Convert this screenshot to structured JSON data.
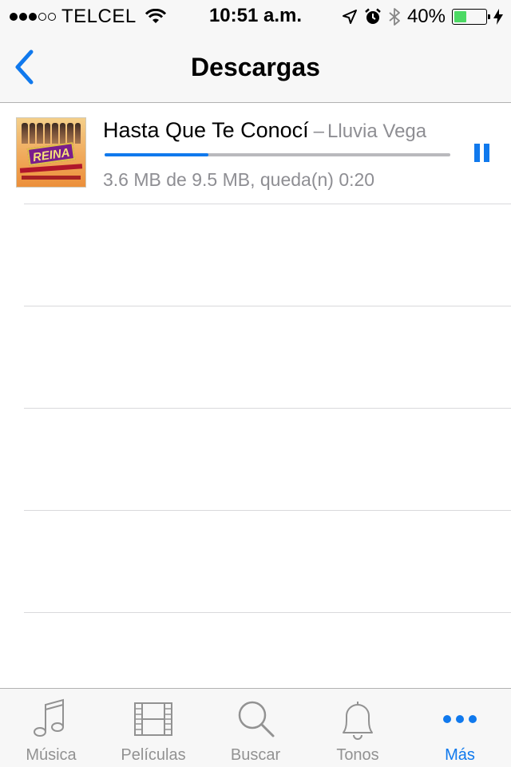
{
  "status_bar": {
    "signal_filled": 3,
    "signal_total": 5,
    "carrier": "TELCEL",
    "time": "10:51 a.m.",
    "battery_percent": "40%",
    "battery_level": 0.4,
    "icons": [
      "wifi-icon",
      "location-arrow-icon",
      "alarm-icon",
      "bluetooth-icon",
      "battery-icon",
      "charging-bolt-icon"
    ]
  },
  "nav": {
    "title": "Descargas",
    "back_icon": "chevron-left-icon"
  },
  "download": {
    "album_icon": "album-art",
    "album_logo_text": "REINA",
    "title": "Hasta Que Te Conocí",
    "separator": "–",
    "artist": "Lluvia Vega",
    "progress": 0.3,
    "status": "3.6 MB de 9.5 MB, queda(n) 0:20",
    "pause_icon": "pause-icon"
  },
  "tabs": [
    {
      "label": "Música",
      "icon": "music-note-icon",
      "active": false
    },
    {
      "label": "Películas",
      "icon": "film-icon",
      "active": false
    },
    {
      "label": "Buscar",
      "icon": "search-icon",
      "active": false
    },
    {
      "label": "Tonos",
      "icon": "bell-icon",
      "active": false
    },
    {
      "label": "Más",
      "icon": "more-dots-icon",
      "active": true
    }
  ],
  "colors": {
    "accent": "#1079ed",
    "inactive": "#929292",
    "secondary_text": "#8e8e93",
    "battery": "#4cd964"
  }
}
